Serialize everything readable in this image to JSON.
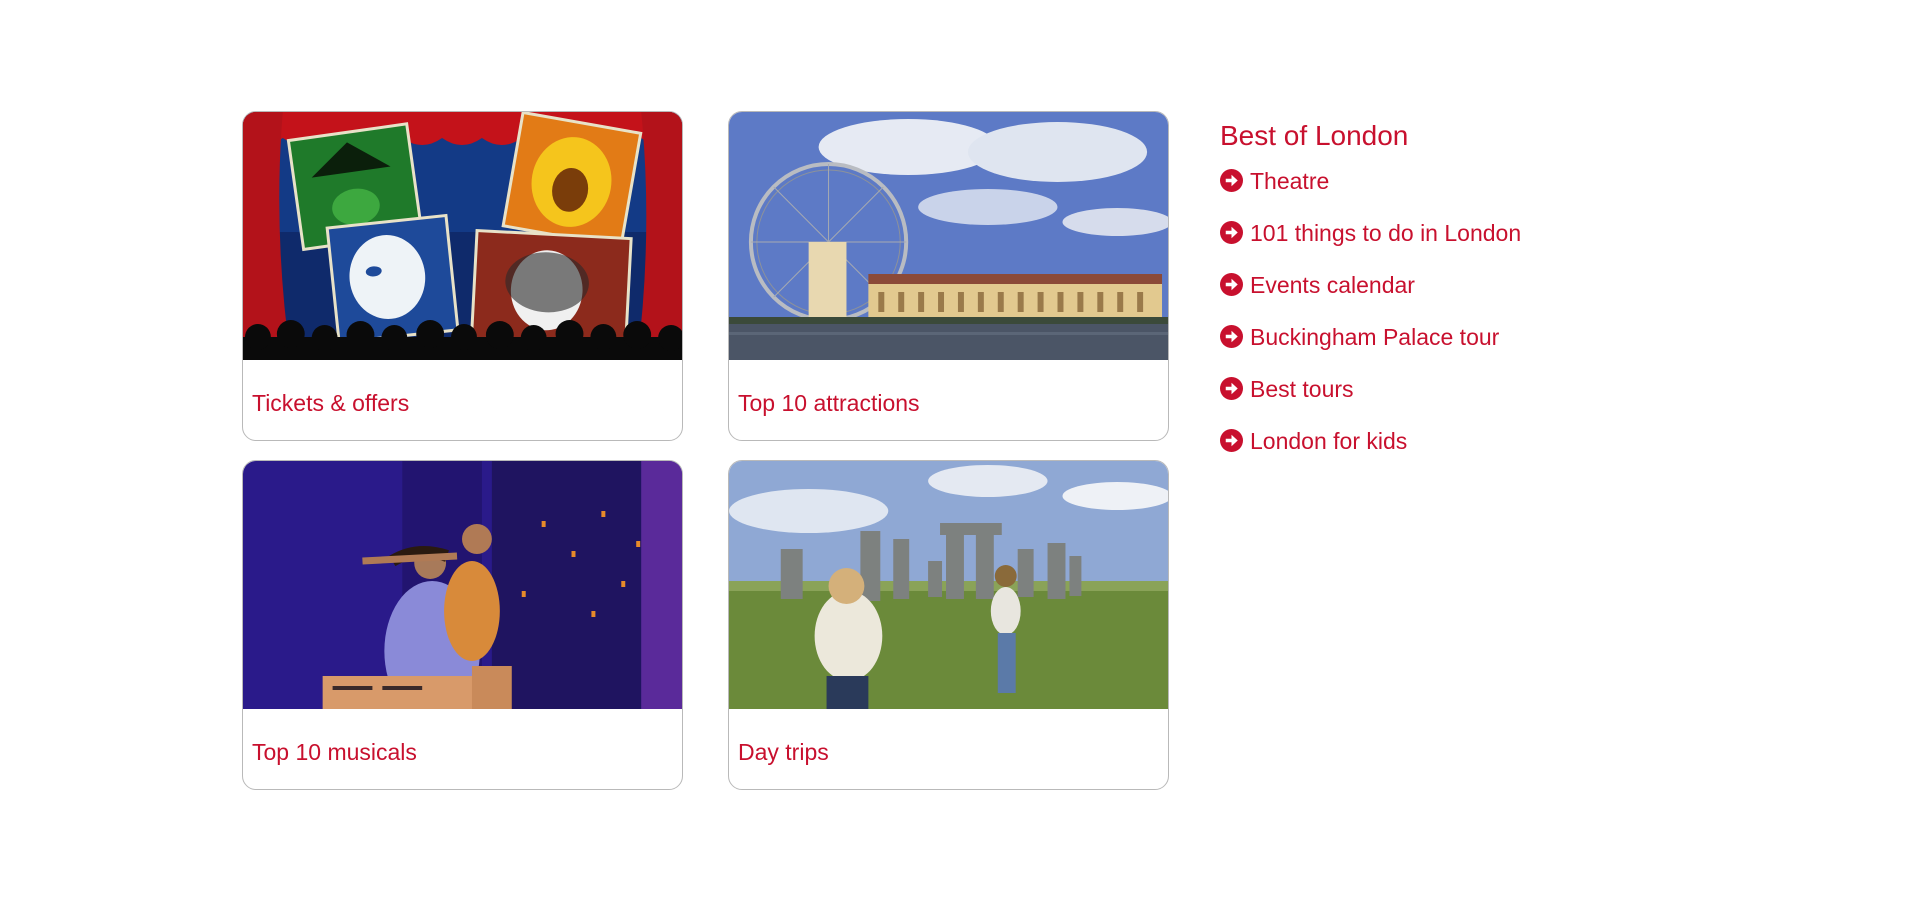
{
  "colors": {
    "accent": "#c8102e",
    "border": "#b9b9b9"
  },
  "cards": [
    {
      "label": "Tickets & offers",
      "image": "west-end-musicals-posters-image"
    },
    {
      "label": "Top 10 attractions",
      "image": "london-eye-county-hall-image"
    },
    {
      "label": "Top 10 musicals",
      "image": "aladdin-stage-scene-image"
    },
    {
      "label": "Day trips",
      "image": "stonehenge-visitors-image"
    }
  ],
  "sidebar": {
    "title": "Best of London",
    "icon": "arrow-circle-right-icon",
    "links": [
      "Theatre",
      "101 things to do in London",
      "Events calendar",
      "Buckingham Palace tour",
      "Best tours",
      "London for kids"
    ]
  }
}
